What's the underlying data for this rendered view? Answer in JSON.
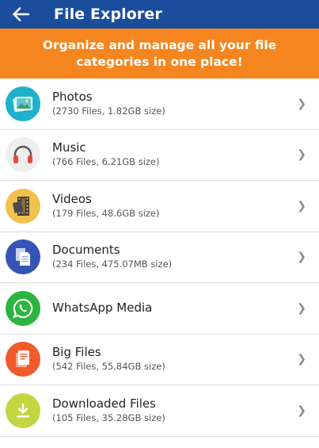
{
  "appbar": {
    "title": "File Explorer",
    "back_icon": "arrow-left-icon",
    "background": "#1a4e9c"
  },
  "banner": {
    "text": "Organize and manage all your file categories in one place!",
    "background": "#f5861f"
  },
  "chevron": "❯",
  "categories": [
    {
      "title": "Photos",
      "subtitle": "(2730 Files, 1.82GB size)",
      "icon": "photos-icon",
      "color": "#1fb1cc"
    },
    {
      "title": "Music",
      "subtitle": "(766 Files, 6.21GB size)",
      "icon": "headphones-icon",
      "color": "#eeeeee"
    },
    {
      "title": "Videos",
      "subtitle": "(179 Files, 48.6GB size)",
      "icon": "film-icon",
      "color": "#f2c04c"
    },
    {
      "title": "Documents",
      "subtitle": "(234 Files, 475.07MB size)",
      "icon": "documents-icon",
      "color": "#3654b3"
    },
    {
      "title": "WhatsApp Media",
      "subtitle": "",
      "icon": "whatsapp-icon",
      "color": "#2ab540"
    },
    {
      "title": "Big Files",
      "subtitle": "(542 Files, 55.84GB size)",
      "icon": "big-files-icon",
      "color": "#f15a2b"
    },
    {
      "title": "Downloaded Files",
      "subtitle": "(105 Files, 35.28GB size)",
      "icon": "download-icon",
      "color": "#c3d641"
    }
  ]
}
